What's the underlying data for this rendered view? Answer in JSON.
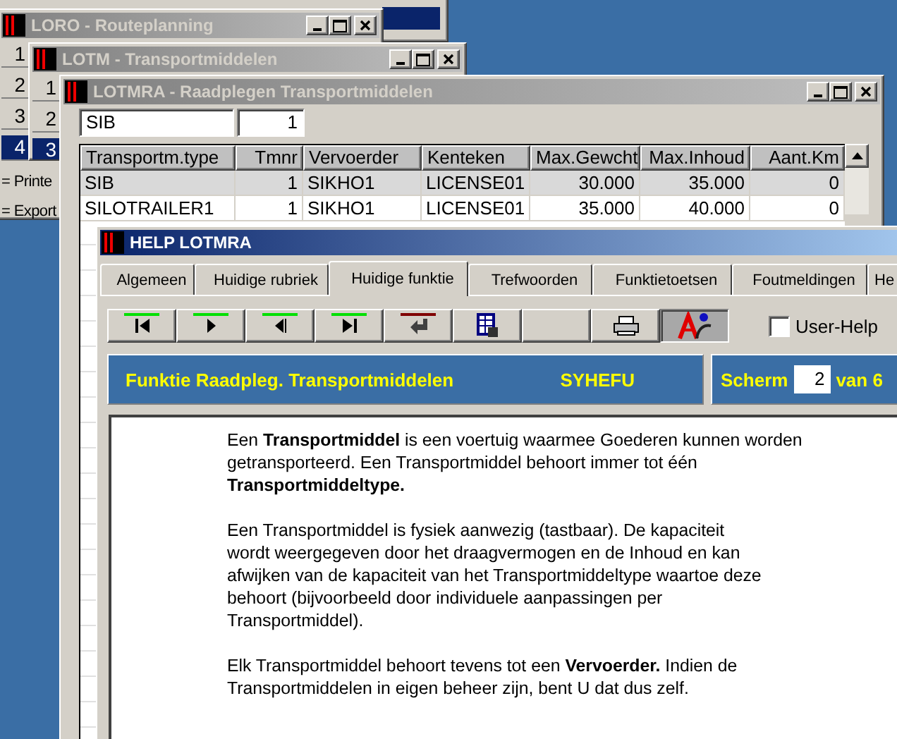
{
  "background_window": {
    "has_selection": true
  },
  "loro_window": {
    "title": "LORO - Routeplanning",
    "rows": [
      {
        "label": "1",
        "selected": false
      },
      {
        "label": "2",
        "selected": false
      },
      {
        "label": "3",
        "selected": false
      },
      {
        "label": "4",
        "selected": true
      }
    ],
    "legend": [
      "= Printe",
      "= Export"
    ]
  },
  "lotm_window": {
    "title": "LOTM - Transportmiddelen",
    "rows": [
      {
        "label": "1",
        "selected": false
      },
      {
        "label": "2",
        "selected": false
      },
      {
        "label": "3",
        "selected": true
      }
    ]
  },
  "lotmra_window": {
    "title": "LOTMRA - Raadplegen Transportmiddelen",
    "filter": {
      "type": "SIB",
      "number": "1"
    },
    "table": {
      "columns": [
        {
          "label": "Transportm.type",
          "kind": "text"
        },
        {
          "label": "Tmnr",
          "kind": "number"
        },
        {
          "label": "Vervoerder",
          "kind": "text"
        },
        {
          "label": "Kenteken",
          "kind": "text"
        },
        {
          "label": "Max.Gewcht",
          "kind": "number"
        },
        {
          "label": "Max.Inhoud",
          "kind": "number"
        },
        {
          "label": "Aant.Km",
          "kind": "number"
        }
      ],
      "rows": [
        {
          "cells": [
            "SIB",
            "1",
            "SIKHO1",
            "LICENSE01",
            "30.000",
            "35.000",
            "0"
          ],
          "selected": true
        },
        {
          "cells": [
            "SILOTRAILER1",
            "1",
            "SIKHO1",
            "LICENSE01",
            "35.000",
            "40.000",
            "0"
          ],
          "selected": false
        }
      ]
    }
  },
  "help_window": {
    "title": "HELP LOTMRA",
    "tabs": [
      {
        "label": "Algemeen",
        "selected": false
      },
      {
        "label": "Huidige rubriek",
        "selected": false
      },
      {
        "label": "Huidige funktie",
        "selected": true
      },
      {
        "label": "Trefwoorden",
        "selected": false
      },
      {
        "label": "Funktietoetsen",
        "selected": false
      },
      {
        "label": "Foutmeldingen",
        "selected": false
      },
      {
        "label": "He",
        "selected": false
      }
    ],
    "toolbar": [
      {
        "kind": "first",
        "pressed": false
      },
      {
        "kind": "next",
        "pressed": false
      },
      {
        "kind": "previous",
        "pressed": false
      },
      {
        "kind": "last",
        "pressed": false
      },
      {
        "kind": "return",
        "pressed": false
      },
      {
        "kind": "table",
        "pressed": false
      },
      {
        "kind": "blank",
        "pressed": false
      },
      {
        "kind": "print",
        "pressed": false
      },
      {
        "kind": "spell",
        "pressed": true
      }
    ],
    "user_help": {
      "label": "User-Help",
      "checked": false
    },
    "function_bar": {
      "title": "Funktie Raadpleg. Transportmiddelen",
      "code": "SYHEFU"
    },
    "screen_indicator": {
      "label": "Scherm",
      "value": "2",
      "suffix": "van 6"
    },
    "paragraphs": [
      "Een **Transportmiddel** is een voertuig waarmee Goederen kunnen worden\ngetransporteerd. Een Transportmiddel behoort immer tot één\n**Transportmiddeltype.**",
      "Een Transportmiddel is fysiek aanwezig (tastbaar). De kapaciteit\nwordt weergegeven door het draagvermogen en de Inhoud en kan\nafwijken van de kapaciteit van het Transportmiddeltype waartoe deze\nbehoort (bijvoorbeeld door individuele aanpassingen per\nTransportmiddel).",
      "Elk Transportmiddel behoort tevens tot een **Vervoerder.** Indien de\nTransportmiddelen in eigen beheer zijn, bent U dat dus zelf."
    ]
  }
}
